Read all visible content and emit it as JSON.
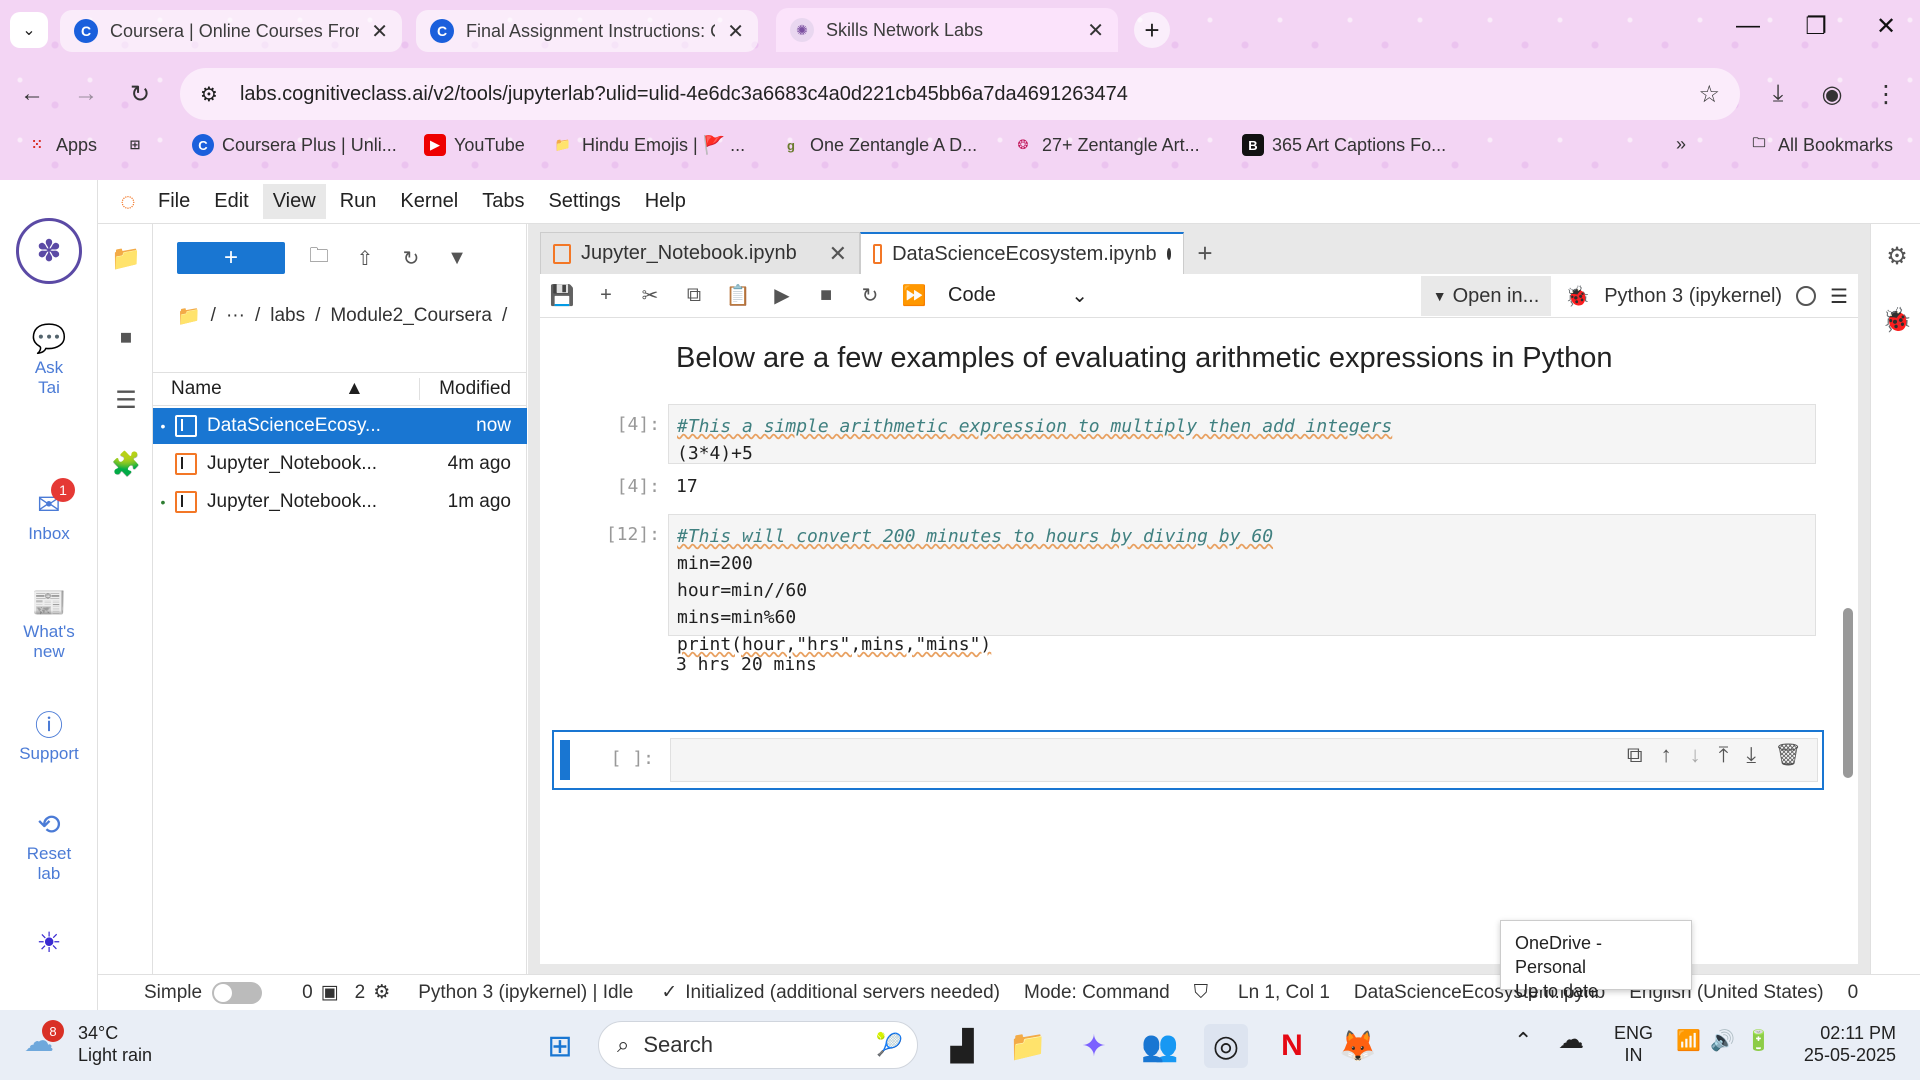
{
  "browser": {
    "tabs": [
      {
        "title": "Coursera | Online Courses From",
        "favicon": "C"
      },
      {
        "title": "Final Assignment Instructions: C",
        "favicon": "C"
      },
      {
        "title": "Skills Network Labs",
        "favicon": "snl-icon"
      }
    ],
    "url": "labs.cognitiveclass.ai/v2/tools/jupyterlab?ulid=ulid-4e6dc3a6683c4a0d221cb45bb6a7da4691263474",
    "bookmarks": [
      {
        "label": "Apps"
      },
      {
        "label": "Coursera Plus | Unli..."
      },
      {
        "label": "YouTube"
      },
      {
        "label": "Hindu Emojis | 🚩 ..."
      },
      {
        "label": "One Zentangle A D..."
      },
      {
        "label": "27+ Zentangle Art..."
      },
      {
        "label": "365 Art Captions Fo..."
      }
    ],
    "all_bookmarks": "All Bookmarks"
  },
  "leftbar": {
    "items": [
      {
        "label": "Ask\nTai"
      },
      {
        "label": "Inbox",
        "badge": "1"
      },
      {
        "label": "What's\nnew"
      },
      {
        "label": "Support"
      },
      {
        "label": "Reset\nlab"
      }
    ]
  },
  "menu": [
    "File",
    "Edit",
    "View",
    "Run",
    "Kernel",
    "Tabs",
    "Settings",
    "Help"
  ],
  "filebrowser": {
    "new_label": "+",
    "breadcrumb": [
      "/",
      "···",
      "/",
      "labs",
      "/",
      "Module2_Coursera",
      "/"
    ],
    "col_name": "Name",
    "col_modified": "Modified",
    "files": [
      {
        "name": "DataScienceEcosy...",
        "modified": "now",
        "selected": true
      },
      {
        "name": "Jupyter_Notebook...",
        "modified": "4m ago"
      },
      {
        "name": "Jupyter_Notebook...",
        "modified": "1m ago"
      }
    ]
  },
  "notebook": {
    "tabs": [
      {
        "title": "Jupyter_Notebook.ipynb"
      },
      {
        "title": "DataScienceEcosystem.ipynb"
      }
    ],
    "cell_type": "Code",
    "open_in": "Open in...",
    "kernel": "Python 3 (ipykernel)",
    "heading": "Below are a few examples of evaluating arithmetic expressions in Python",
    "cells": [
      {
        "prompt": "[4]:",
        "comment": "#This a simple arithmetic expression to multiply then add integers",
        "code": "(3*4)+5",
        "out_prompt": "[4]:",
        "output": "17"
      },
      {
        "prompt": "[12]:",
        "comment": "#This will convert 200 minutes to hours by diving by 60",
        "lines": [
          "min=200",
          "hour=min//60",
          "mins=min%60",
          "print(hour,\"hrs\",mins,\"mins\")"
        ],
        "output": "3 hrs 20 mins"
      },
      {
        "prompt": "[ ]:"
      }
    ]
  },
  "status": {
    "simple": "Simple",
    "terminals": "0",
    "kernels": "2",
    "kernel_state": "Python 3 (ipykernel) | Idle",
    "init": "Initialized (additional servers needed)",
    "mode": "Mode: Command",
    "cursor": "Ln 1, Col 1",
    "file": "DataScienceEcosystem.ipynb",
    "lang": "English (United States)",
    "count": "0"
  },
  "tooltip": {
    "line1": "OneDrive - Personal",
    "line2": "Up to date"
  },
  "taskbar": {
    "weather_badge": "8",
    "temp": "34°C",
    "weather": "Light rain",
    "search": "Search",
    "lang1": "ENG",
    "lang2": "IN",
    "time": "02:11 PM",
    "date": "25-05-2025"
  }
}
